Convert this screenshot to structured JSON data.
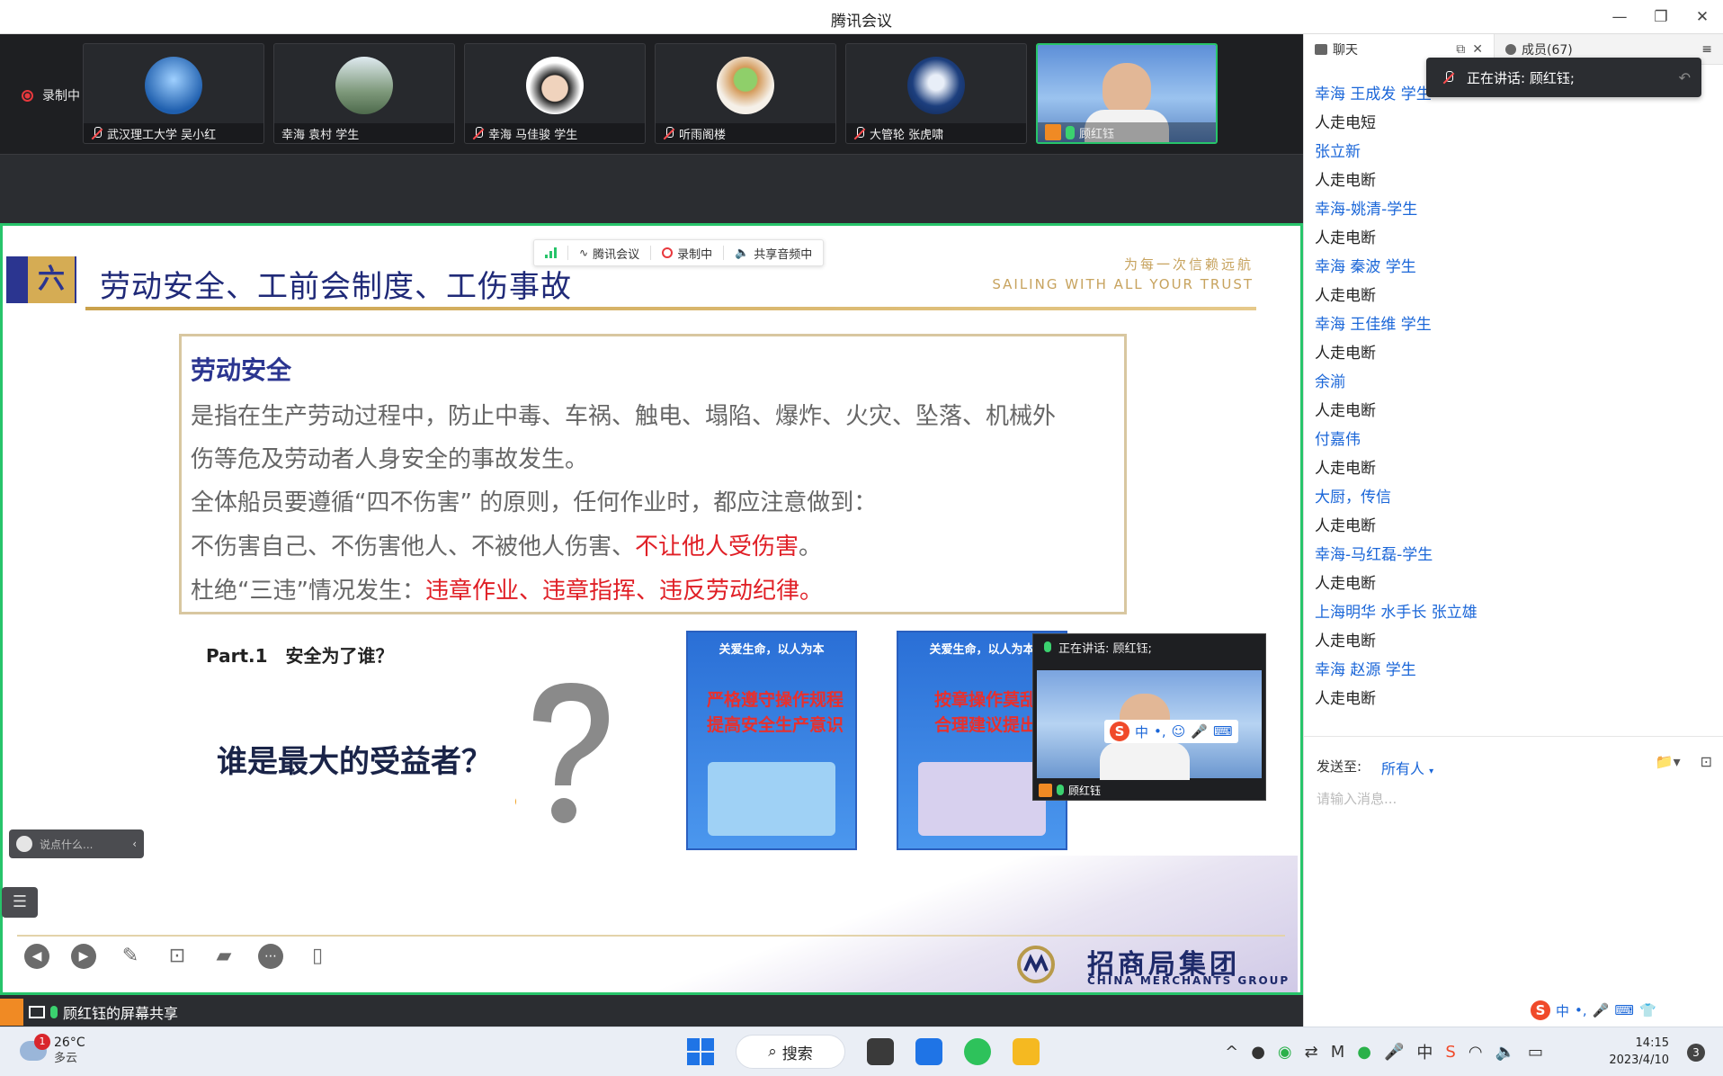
{
  "window": {
    "title": "腾讯会议"
  },
  "recording": {
    "label": "录制中"
  },
  "participants": [
    {
      "name": "武汉理工大学 吴小红",
      "mic": "off"
    },
    {
      "name": "幸海 袁村 学生",
      "mic": "none"
    },
    {
      "name": "幸海 马佳骏 学生",
      "mic": "off"
    },
    {
      "name": "听雨阁楼",
      "mic": "off"
    },
    {
      "name": "大管轮 张虎啸",
      "mic": "off"
    },
    {
      "name": "顾红钰",
      "mic": "on"
    }
  ],
  "float_toolbar": {
    "app": "腾讯会议",
    "recording": "录制中",
    "audio": "共享音频中"
  },
  "slide": {
    "num": "六",
    "title": "劳动安全、工前会制度、工伤事故",
    "slogan_cn": "为每一次信赖远航",
    "slogan_en": "SAILING WITH ALL YOUR TRUST",
    "box_heading": "劳动安全",
    "line1": "是指在生产劳动过程中，防止中毒、车祸、触电、塌陷、爆炸、火灾、坠落、机械外",
    "line2": "伤等危及劳动者人身安全的事故发生。",
    "line3": "全体船员要遵循“四不伤害” 的原则，任何作业时，都应注意做到：",
    "line4a": "不伤害自己、不伤害他人、不被他人伤害、",
    "line4b": "不让他人受伤害",
    "line4c": "。",
    "line5a": "杜绝“三违”情况发生：",
    "line5b": "违章作业、违章指挥、违反劳动纪律。",
    "part": "Part.1　安全为了谁？",
    "who": "谁是最大的受益者？",
    "poster1": {
      "head": "关爱生命，以人为本",
      "l1": "严格遵守操作规程",
      "l2": "提高安全生产意识"
    },
    "poster2": {
      "head": "关爱生命，以人为本",
      "l1": "按章操作莫乱",
      "l2": "合理建议提出"
    },
    "company_cn": "招商局集团",
    "company_en": "CHINA MERCHANTS GROUP"
  },
  "pip": {
    "speaking": "正在讲话: 顾红钰;",
    "name": "顾红钰"
  },
  "danmaku": {
    "placeholder": "说点什么..."
  },
  "share_status": "顾红钰的屏幕共享",
  "panel": {
    "tab_chat": "聊天",
    "tab_members": "成员(67)",
    "speaking": "正在讲话: 顾红钰;",
    "messages": [
      {
        "type": "sender",
        "text": "幸海 王成发 学生"
      },
      {
        "type": "text",
        "text": "人走电短"
      },
      {
        "type": "sender",
        "text": "张立新"
      },
      {
        "type": "text",
        "text": "人走电断"
      },
      {
        "type": "sender",
        "text": "幸海-姚清-学生"
      },
      {
        "type": "text",
        "text": "人走电断"
      },
      {
        "type": "sender",
        "text": "幸海 秦波 学生"
      },
      {
        "type": "text",
        "text": "人走电断"
      },
      {
        "type": "sender",
        "text": "幸海 王佳维 学生"
      },
      {
        "type": "text",
        "text": "人走电断"
      },
      {
        "type": "sender",
        "text": "余湔"
      },
      {
        "type": "text",
        "text": "人走电断"
      },
      {
        "type": "sender",
        "text": "付嘉伟"
      },
      {
        "type": "text",
        "text": "人走电断"
      },
      {
        "type": "sender",
        "text": "大厨，传信"
      },
      {
        "type": "text",
        "text": "人走电断"
      },
      {
        "type": "sender",
        "text": "幸海-马红磊-学生"
      },
      {
        "type": "text",
        "text": "人走电断"
      },
      {
        "type": "sender",
        "text": "上海明华 水手长 张立雄"
      },
      {
        "type": "text",
        "text": "人走电断"
      },
      {
        "type": "sender",
        "text": "幸海 赵源 学生"
      },
      {
        "type": "text",
        "text": "人走电断"
      }
    ],
    "send_to_label": "发送至:",
    "send_to_target": "所有人",
    "input_placeholder": "请输入消息..."
  },
  "ime": {
    "lang": "中"
  },
  "taskbar": {
    "weather_badge": "1",
    "temp": "26°C",
    "condition": "多云",
    "search": "搜索",
    "time": "14:15",
    "date": "2023/4/10",
    "notifications": "3"
  }
}
